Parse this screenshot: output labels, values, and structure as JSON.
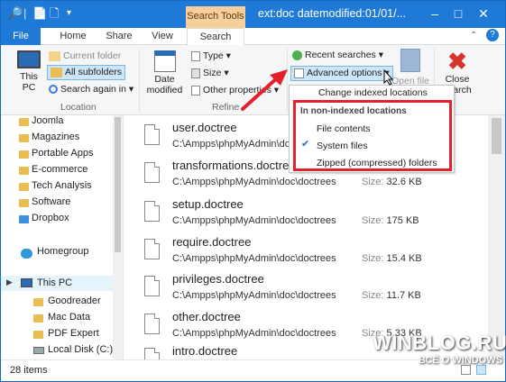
{
  "title_bar": {
    "context_tab": "Search Tools",
    "window_title": "ext:doc datemodified:01/01/..."
  },
  "tabs": [
    "File",
    "Home",
    "Share",
    "View",
    "Search"
  ],
  "ribbon": {
    "this_pc": "This\nPC",
    "current_folder": "Current folder",
    "all_subfolders": "All subfolders",
    "search_again_in": "Search again in",
    "location_group": "Location",
    "date_modified": "Date\nmodified",
    "type": "Type",
    "size": "Size",
    "other_properties": "Other properties",
    "refine_group": "Refine",
    "recent_searches": "Recent searches",
    "advanced_options": "Advanced options",
    "open_file": "Open file",
    "close_search": "Close\nsearch"
  },
  "dropdown": {
    "change_indexed": "Change indexed locations",
    "heading": "In non-indexed locations",
    "items": [
      {
        "label": "File contents",
        "checked": false
      },
      {
        "label": "System files",
        "checked": true
      },
      {
        "label": "Zipped (compressed) folders",
        "checked": false
      }
    ]
  },
  "nav": {
    "folders": [
      "Joomla",
      "Magazines",
      "Portable Apps",
      "E-commerce",
      "Tech Analysis",
      "Software",
      "Dropbox"
    ],
    "homegroup": "Homegroup",
    "this_pc": "This PC",
    "pc_items": [
      "Goodreader",
      "Mac Data",
      "PDF Expert",
      "Local Disk (C:)"
    ]
  },
  "files": [
    {
      "name": "user.doctree",
      "path": "C:\\Ampps\\phpMyAdmin\\doc\\doctrees",
      "size_label": "",
      "size": ""
    },
    {
      "name": "transformations.doctree",
      "path": "C:\\Ampps\\phpMyAdmin\\doc\\doctrees",
      "size_label": "Size:",
      "size": "32.6 KB"
    },
    {
      "name": "setup.doctree",
      "path": "C:\\Ampps\\phpMyAdmin\\doc\\doctrees",
      "size_label": "Size:",
      "size": "175 KB"
    },
    {
      "name": "require.doctree",
      "path": "C:\\Ampps\\phpMyAdmin\\doc\\doctrees",
      "size_label": "Size:",
      "size": "15.4 KB"
    },
    {
      "name": "privileges.doctree",
      "path": "C:\\Ampps\\phpMyAdmin\\doc\\doctrees",
      "size_label": "Size:",
      "size": "11.7 KB"
    },
    {
      "name": "other.doctree",
      "path": "C:\\Ampps\\phpMyAdmin\\doc\\doctrees",
      "size_label": "Size:",
      "size": "5.33 KB"
    },
    {
      "name": "intro.doctree",
      "path": "",
      "size_label": "",
      "size": ""
    }
  ],
  "status": {
    "item_count": "28 items"
  },
  "watermark": {
    "line1": "WINBLOG.RU",
    "line2": "ВСЁ О WINDOWS"
  },
  "colors": {
    "accent": "#1e7ad6",
    "context_tab": "#f7cf9b",
    "highlight_box": "#e5202a",
    "arrow": "#e5202a"
  }
}
